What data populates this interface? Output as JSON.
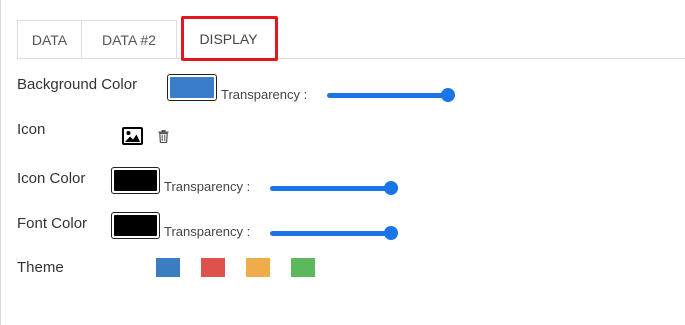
{
  "tabs": [
    {
      "label": "DATA"
    },
    {
      "label": "DATA #2"
    },
    {
      "label": "DISPLAY"
    }
  ],
  "active_tab": "DISPLAY",
  "rows": {
    "background": {
      "label": "Background Color",
      "color": "#3a7dc9",
      "transparency_label": "Transparency :",
      "transparency": 1.0
    },
    "icon": {
      "label": "Icon",
      "icons": [
        "image-icon",
        "trash-icon"
      ]
    },
    "icon_color": {
      "label": "Icon Color",
      "color": "#000000",
      "transparency_label": "Transparency :",
      "transparency": 1.0
    },
    "font_color": {
      "label": "Font Color",
      "color": "#000000",
      "transparency_label": "Transparency :",
      "transparency": 1.0
    },
    "theme": {
      "label": "Theme",
      "swatches": [
        "#3a7dc0",
        "#df514b",
        "#f0ab4a",
        "#5cb85c"
      ]
    }
  },
  "colors": {
    "accent": "#1a76e8",
    "highlight": "#e2161c"
  }
}
